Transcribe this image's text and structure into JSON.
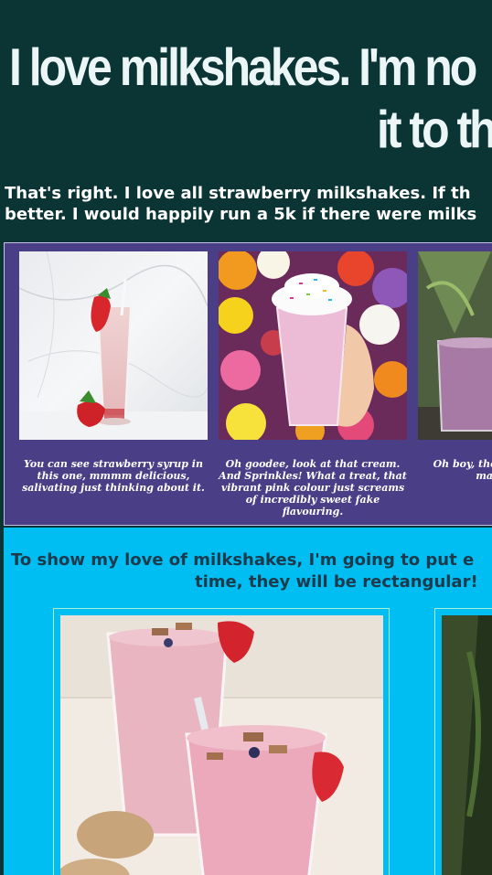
{
  "header": {
    "title_line1": "I love milkshakes. I'm no",
    "title_line2": "it to th"
  },
  "intro": {
    "line1": "That's right. I love all strawberry milkshakes. If th",
    "line2": "better. I would happily run a 5k if there were milks"
  },
  "gallery": {
    "items": [
      {
        "caption": "You can see strawberry syrup in this one, mmmm delicious, salivating just thinking about it."
      },
      {
        "caption": "Oh goodee, look at that cream. And Sprinkles! What a treat, that vibrant pink colour just screams of incredibly sweet fake flavouring."
      },
      {
        "caption": "Oh boy, thos strawberry was made wi how"
      }
    ]
  },
  "section2": {
    "heading_line1": "To show my love of milkshakes, I'm going to put e",
    "heading_line2": "time, they will be rectangular!"
  },
  "colors": {
    "header_bg": "#0b3434",
    "gallery_bg": "#4a3f86",
    "blue_bg": "#00bdf2",
    "heading_text": "#1c3a4c"
  }
}
